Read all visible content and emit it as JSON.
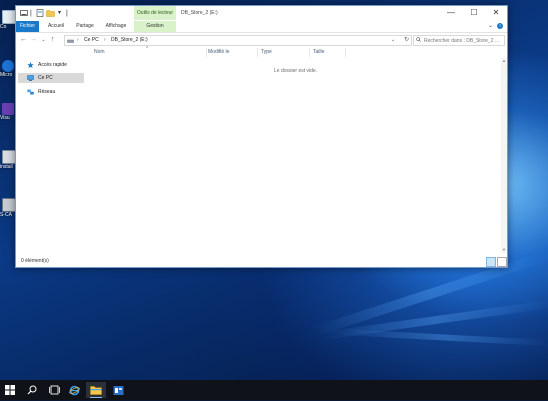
{
  "desktop": {
    "icons": [
      {
        "name": "recycle-bin",
        "label": "Co"
      },
      {
        "name": "edge",
        "label": "Micro"
      },
      {
        "name": "visual-studio",
        "label": "Visu"
      },
      {
        "name": "installer",
        "label": "install"
      },
      {
        "name": "ssms",
        "label": "S-CA"
      }
    ]
  },
  "window": {
    "title": "DB_Store_2 (E:)",
    "context_group": "Outils de lecteur",
    "controls": {
      "minimize": "—",
      "maximize": "☐",
      "close": "✕"
    }
  },
  "ribbon": {
    "tabs": [
      "Fichier",
      "Accueil",
      "Partage",
      "Affichage",
      "Gestion"
    ]
  },
  "address": {
    "segments": [
      "Ce PC",
      "DB_Store_2 (E:)"
    ],
    "search_placeholder": "Rechercher dans : DB_Store_2 ..."
  },
  "navigation": {
    "items": [
      {
        "label": "Accès rapide",
        "icon": "star-icon"
      },
      {
        "label": "Ce PC",
        "icon": "computer-icon",
        "selected": true
      },
      {
        "label": "Réseau",
        "icon": "network-icon"
      }
    ]
  },
  "columns": [
    "Nom",
    "Modifié le",
    "Type",
    "Taille"
  ],
  "content": {
    "empty_message": "Le dossier est vide."
  },
  "status": {
    "item_count": "0 élément(s)"
  },
  "taskbar": {
    "items": [
      "start-icon",
      "search-icon",
      "task-view-icon",
      "file-explorer-icon",
      "internet-explorer-icon",
      "server-manager-icon"
    ]
  }
}
